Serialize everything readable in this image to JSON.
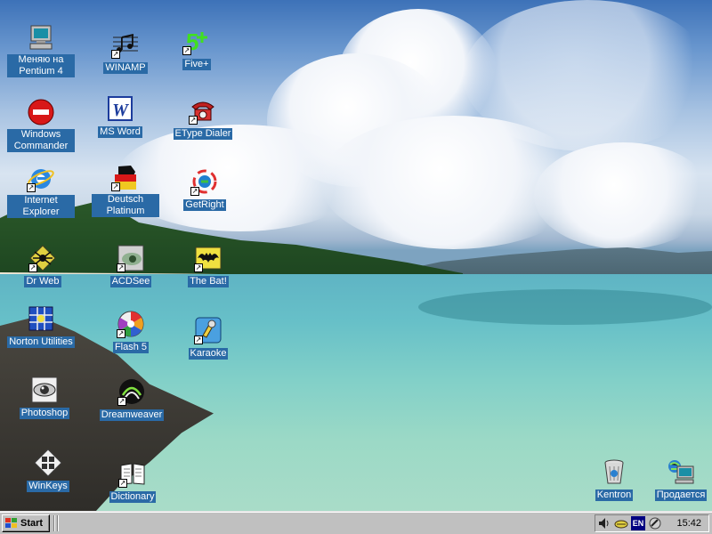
{
  "desktop": {
    "icons": [
      {
        "label": "Меняю на Pentium 4",
        "icon": "my-computer-icon"
      },
      {
        "label": "Windows Commander",
        "icon": "no-entry-icon"
      },
      {
        "label": "Internet Explorer",
        "icon": "internet-explorer-icon"
      },
      {
        "label": "Dr Web",
        "icon": "spider-icon"
      },
      {
        "label": "Norton Utilities",
        "icon": "norton-utilities-icon"
      },
      {
        "label": "Photoshop",
        "icon": "photoshop-eye-icon"
      },
      {
        "label": "WinKeys",
        "icon": "winkeys-icon"
      },
      {
        "label": "WINAMP",
        "icon": "music-notes-icon"
      },
      {
        "label": "MS Word",
        "icon": "word-icon"
      },
      {
        "label": "Deutsch Platinum",
        "icon": "germany-flag-icon"
      },
      {
        "label": "ACDSee",
        "icon": "acdsee-eye-icon"
      },
      {
        "label": "Flash 5",
        "icon": "flash-icon"
      },
      {
        "label": "Dreamweaver",
        "icon": "dreamweaver-icon"
      },
      {
        "label": "Dictionary",
        "icon": "book-icon"
      },
      {
        "label": "Five+",
        "icon": "five-plus-icon"
      },
      {
        "label": "EType Dialer",
        "icon": "telephone-icon"
      },
      {
        "label": "GetRight",
        "icon": "getright-icon"
      },
      {
        "label": "The Bat!",
        "icon": "bat-icon"
      },
      {
        "label": "Karaoke",
        "icon": "karaoke-icon"
      },
      {
        "label": "Kentron",
        "icon": "recycle-bin-icon"
      },
      {
        "label": "Продается",
        "icon": "network-computer-icon"
      }
    ]
  },
  "taskbar": {
    "start_label": "Start",
    "language": "EN",
    "clock": "15:42"
  },
  "colors": {
    "label_bg": "#2a6aa6",
    "taskbar": "#c0c0c0"
  }
}
